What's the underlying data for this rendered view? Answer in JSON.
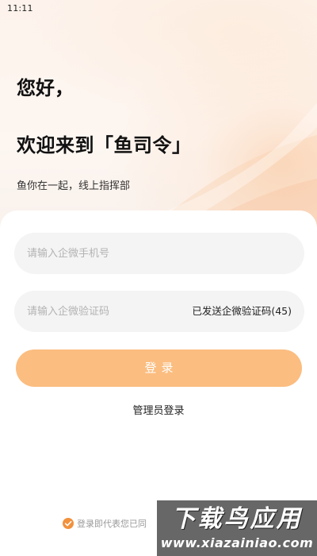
{
  "status_bar": {
    "time": "11:11"
  },
  "hero": {
    "greeting": "您好，",
    "welcome": "欢迎来到「鱼司令」",
    "slogan": "鱼你在一起，线上指挥部"
  },
  "form": {
    "phone_placeholder": "请输入企微手机号",
    "phone_value": "",
    "code_placeholder": "请输入企微验证码",
    "code_value": "",
    "code_status": "已发送企微验证码(45)",
    "login_label": "登录",
    "admin_login_label": "管理员登录"
  },
  "agreement": {
    "checked": true,
    "text": "登录即代表您已同"
  },
  "watermark": {
    "logo": "下载鸟应用",
    "url": "www.xiazainiao.com"
  },
  "colors": {
    "accent": "#f2913d",
    "login_button": "#fbbd80",
    "input_background": "#f4f4f4"
  }
}
